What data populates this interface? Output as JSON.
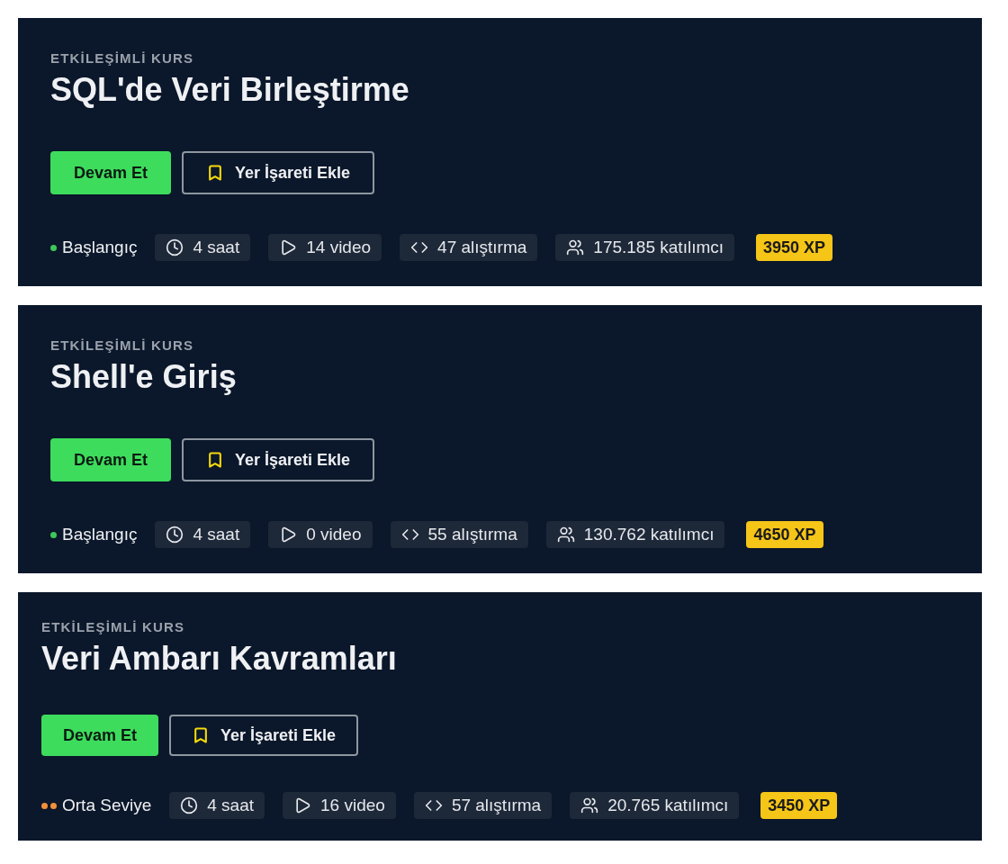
{
  "courses": [
    {
      "eyebrow": "ETKİLEŞİMLİ KURS",
      "title": "SQL'de Veri Birleştirme",
      "primary_button": "Devam Et",
      "bookmark_button": "Yer İşareti Ekle",
      "difficulty": {
        "kind": "beginner",
        "label": "Başlangıç",
        "color": "#3cc85a"
      },
      "stats": [
        {
          "kind": "duration",
          "text": "4 saat"
        },
        {
          "kind": "videos",
          "text": "14 video"
        },
        {
          "kind": "exercises",
          "text": "47 alıştırma"
        },
        {
          "kind": "participants",
          "text": "175.185 katılımcı"
        }
      ],
      "xp": "3950 XP"
    },
    {
      "eyebrow": "ETKİLEŞİMLİ KURS",
      "title": "Shell'e Giriş",
      "primary_button": "Devam Et",
      "bookmark_button": "Yer İşareti Ekle",
      "difficulty": {
        "kind": "beginner",
        "label": "Başlangıç",
        "color": "#3cc85a"
      },
      "stats": [
        {
          "kind": "duration",
          "text": "4 saat"
        },
        {
          "kind": "videos",
          "text": "0 video"
        },
        {
          "kind": "exercises",
          "text": "55 alıştırma"
        },
        {
          "kind": "participants",
          "text": "130.762 katılımcı"
        }
      ],
      "xp": "4650 XP"
    },
    {
      "eyebrow": "ETKİLEŞİMLİ KURS",
      "title": "Veri Ambarı Kavramları",
      "primary_button": "Devam Et",
      "bookmark_button": "Yer İşareti Ekle",
      "difficulty": {
        "kind": "intermediate",
        "label": "Orta Seviye",
        "color": "#f0903a"
      },
      "stats": [
        {
          "kind": "duration",
          "text": "4 saat"
        },
        {
          "kind": "videos",
          "text": "16 video"
        },
        {
          "kind": "exercises",
          "text": "57 alıştırma"
        },
        {
          "kind": "participants",
          "text": "20.765 katılımcı"
        }
      ],
      "xp": "3450 XP"
    }
  ]
}
